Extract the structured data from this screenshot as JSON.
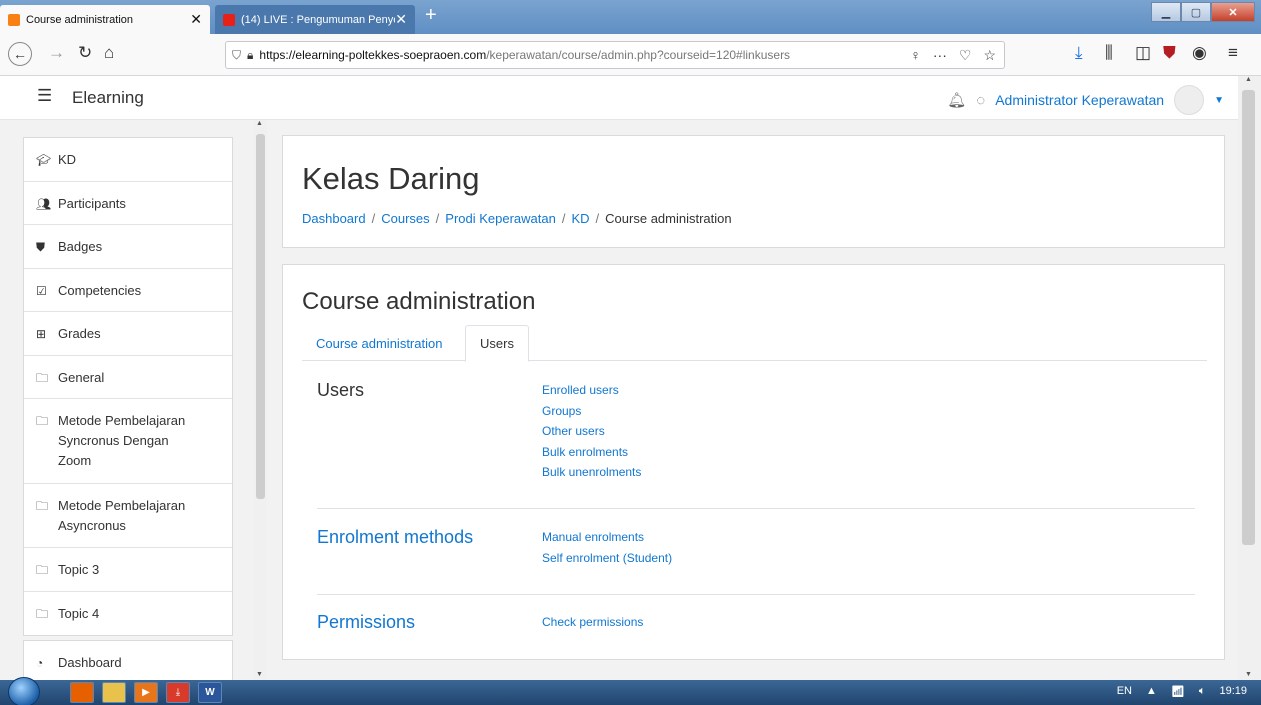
{
  "browser": {
    "tabs": [
      {
        "label": "Course administration",
        "active": true
      },
      {
        "label": "(14) LIVE : Pengumuman Penye",
        "active": false
      }
    ],
    "url_host": "https://elearning-poltekkes-soepraoen.com",
    "url_path": "/keperawatan/course/admin.php?courseid=120#linkusers",
    "nav_icons": [
      "back-icon",
      "forward-icon",
      "reload-icon",
      "home-icon"
    ],
    "toolbar_icons": [
      "download-icon",
      "library-icon",
      "sidebar-icon",
      "ublock-icon",
      "account-icon",
      "menu-icon"
    ]
  },
  "header": {
    "brand": "Elearning",
    "user_name": "Administrator Keperawatan"
  },
  "sidebar": {
    "items": [
      {
        "label": "KD",
        "icon": "graduation-cap-icon"
      },
      {
        "label": "Participants",
        "icon": "users-icon"
      },
      {
        "label": "Badges",
        "icon": "shield-icon"
      },
      {
        "label": "Competencies",
        "icon": "checkbox-icon"
      },
      {
        "label": "Grades",
        "icon": "table-icon"
      },
      {
        "label": "General",
        "icon": "folder-icon"
      },
      {
        "label": "Metode Pembelajaran Syncronus Dengan Zoom",
        "icon": "folder-icon"
      },
      {
        "label": "Metode Pembelajaran Asyncronus",
        "icon": "folder-icon"
      },
      {
        "label": "Topic 3",
        "icon": "folder-icon"
      },
      {
        "label": "Topic 4",
        "icon": "folder-icon"
      }
    ],
    "dashboard": "Dashboard"
  },
  "course": {
    "title": "Kelas Daring",
    "breadcrumb": [
      "Dashboard",
      "Courses",
      "Prodi Keperawatan",
      "KD",
      "Course administration"
    ]
  },
  "admin": {
    "title": "Course administration",
    "tabs": [
      "Course administration",
      "Users"
    ],
    "sections": [
      {
        "heading": "Users",
        "links": [
          "Enrolled users",
          "Groups",
          "Other users",
          "Bulk enrolments",
          "Bulk unenrolments"
        ]
      },
      {
        "heading": "Enrolment methods",
        "links": [
          "Manual enrolments",
          "Self enrolment (Student)"
        ]
      },
      {
        "heading": "Permissions",
        "links": [
          "Check permissions"
        ]
      }
    ]
  },
  "taskbar": {
    "lang": "EN",
    "time": "19:19"
  },
  "colors": {
    "link": "#1177d1",
    "background": "#f2f2f2"
  }
}
